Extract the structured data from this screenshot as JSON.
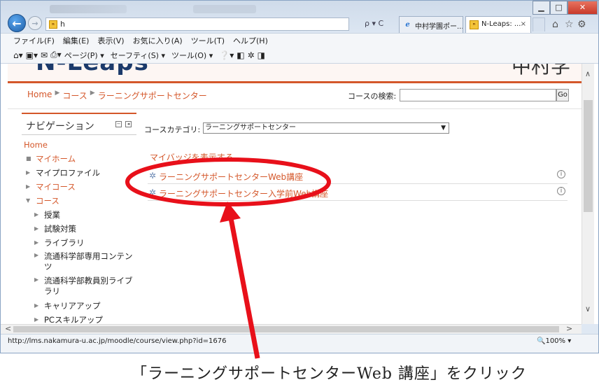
{
  "browser": {
    "address_url": "h",
    "tabs": [
      {
        "label": "中村学園ポー...",
        "icon": "ie-icon"
      },
      {
        "label": "N-Leaps: ...",
        "icon": "n-favicon",
        "close": "×"
      }
    ],
    "window_controls": {
      "minimize": "▁",
      "maximize": "□",
      "close": "✕"
    },
    "menu": [
      "ファイル(F)",
      "編集(E)",
      "表示(V)",
      "お気に入り(A)",
      "ツール(T)",
      "ヘルプ(H)"
    ],
    "command_bar": [
      "ページ(P) ▾",
      "セーフティ(S) ▾",
      "ツール(O) ▾"
    ],
    "addr_tools": "ρ ▾ C",
    "status_url": "http://lms.nakamura-u.ac.jp/moodle/course/view.php?id=1676",
    "zoom": "🔍100%  ▾"
  },
  "page": {
    "breadcrumb": [
      "Home",
      "コース",
      "ラーニングサポートセンター"
    ],
    "search_label": "コースの検索:",
    "search_value": "",
    "go_label": "Go",
    "navigation": {
      "title": "ナビゲーション",
      "items": [
        {
          "label": "Home",
          "style": "home"
        },
        {
          "label": "マイホーム",
          "marker": "■",
          "style": "orange"
        },
        {
          "label": "マイプロファイル",
          "marker": "▶",
          "style": "plain"
        },
        {
          "label": "マイコース",
          "marker": "▶",
          "style": "orange"
        },
        {
          "label": "コース",
          "marker": "▼",
          "style": "orange"
        },
        {
          "label": "授業",
          "marker": "▶",
          "style": "sub"
        },
        {
          "label": "試験対策",
          "marker": "▶",
          "style": "sub"
        },
        {
          "label": "ライブラリ",
          "marker": "▶",
          "style": "sub"
        },
        {
          "label": "流通科学部専用コンテンツ",
          "marker": "▶",
          "style": "sub wrap"
        },
        {
          "label": "流通科学部教員別ライブラリ",
          "marker": "▶",
          "style": "sub wrap"
        },
        {
          "label": "キャリアアップ",
          "marker": "▶",
          "style": "sub"
        },
        {
          "label": "PCスキルアップ",
          "marker": "▶",
          "style": "sub"
        }
      ]
    },
    "category_label": "コースカテゴリ:",
    "category_selected": "ラーニングサポートセンター",
    "my_badges": "マイバッジを表示する",
    "courses": [
      {
        "name": "ラーニングサポートセンターWeb講座",
        "info": "i"
      },
      {
        "name": "ラーニングサポートセンター入学前Web講座",
        "info": "i"
      }
    ]
  },
  "annotation": {
    "caption": "「ラーニングサポートセンターWeb 講座」をクリック",
    "color": "#e8101a"
  }
}
